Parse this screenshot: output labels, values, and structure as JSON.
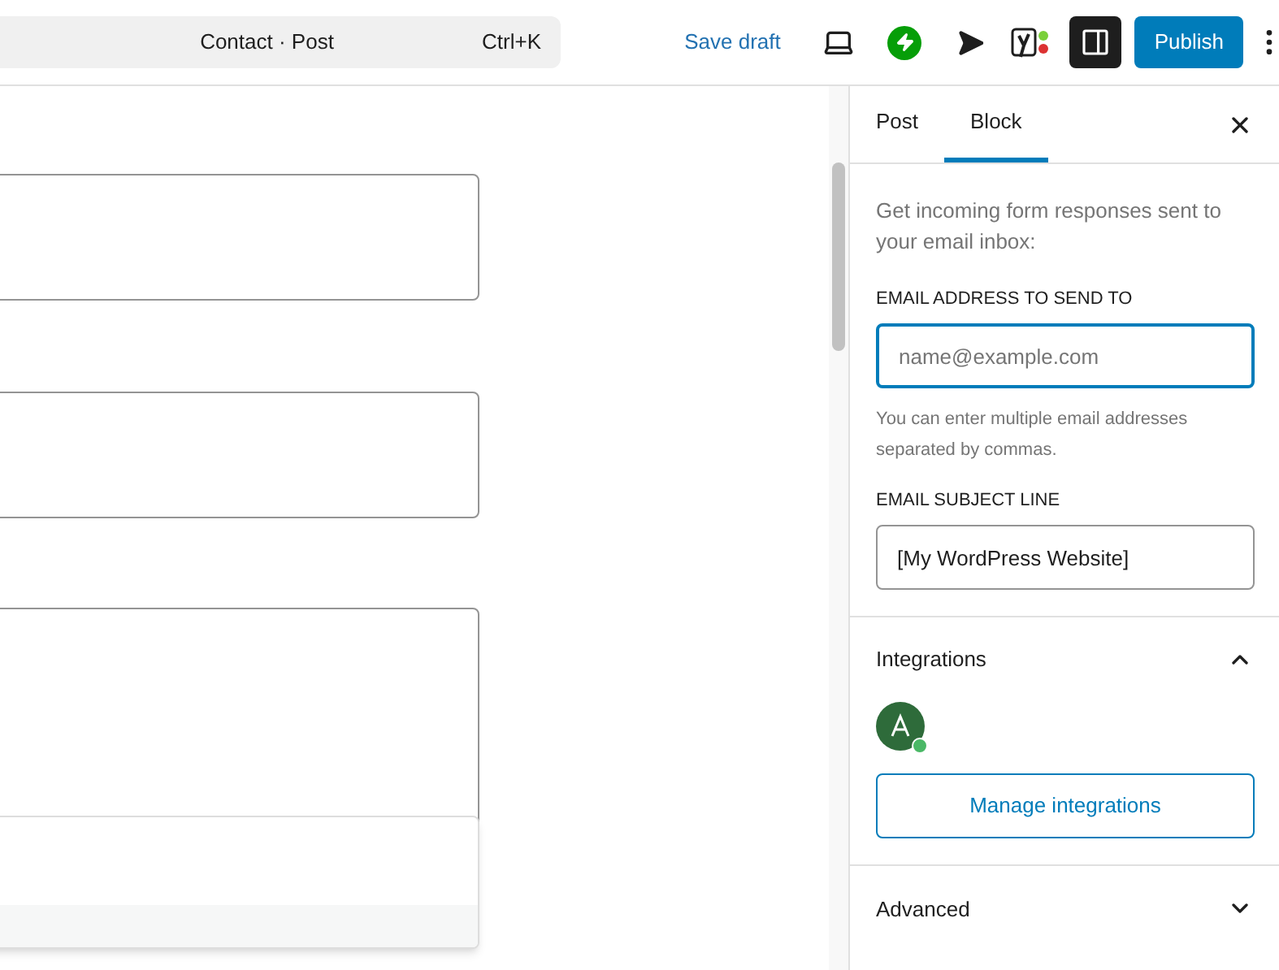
{
  "top_bar": {
    "command": {
      "title": "Contact · Post",
      "shortcut": "Ctrl+K"
    },
    "save_draft": "Save draft",
    "sidebar_toggle": {
      "selected": true
    },
    "publish": "Publish"
  },
  "sidebar": {
    "tabs": [
      {
        "label": "Post",
        "selected": false
      },
      {
        "label": "Block",
        "selected": true
      }
    ],
    "email_section": {
      "description": "Get incoming form responses sent to your email inbox:",
      "fields": [
        {
          "label": "EMAIL ADDRESS TO SEND TO",
          "placeholder": "name@example.com",
          "focused": true,
          "help": "You can enter multiple email addresses separated by commas."
        },
        {
          "label": "EMAIL SUBJECT LINE",
          "value": "[My WordPress Website]",
          "focused": false
        }
      ]
    },
    "integrations": {
      "title": "Integrations",
      "expanded": true,
      "button": "Manage integrations"
    },
    "advanced": {
      "title": "Advanced",
      "expanded": false
    }
  }
}
